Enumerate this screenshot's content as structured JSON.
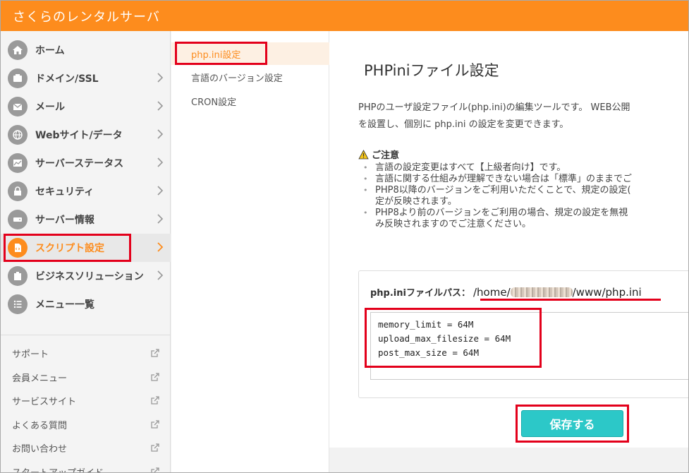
{
  "header": {
    "logo": "さくらのレンタルサーバ"
  },
  "sidebar": {
    "items": [
      {
        "label": "ホーム",
        "icon": "home-icon",
        "chevron": false
      },
      {
        "label": "ドメイン/SSL",
        "icon": "domain-icon",
        "chevron": true
      },
      {
        "label": "メール",
        "icon": "mail-icon",
        "chevron": true
      },
      {
        "label": "Webサイト/データ",
        "icon": "globe-icon",
        "chevron": true
      },
      {
        "label": "サーバーステータス",
        "icon": "chart-icon",
        "chevron": true
      },
      {
        "label": "セキュリティ",
        "icon": "lock-icon",
        "chevron": true
      },
      {
        "label": "サーバー情報",
        "icon": "server-icon",
        "chevron": true
      },
      {
        "label": "スクリプト設定",
        "icon": "script-icon",
        "chevron": true,
        "active": true
      },
      {
        "label": "ビジネスソリューション",
        "icon": "business-icon",
        "chevron": true
      },
      {
        "label": "メニュー一覧",
        "icon": "list-icon",
        "chevron": false
      }
    ],
    "links": [
      "サポート",
      "会員メニュー",
      "サービスサイト",
      "よくある質問",
      "お問い合わせ",
      "スタートアップガイド"
    ]
  },
  "subnav": {
    "items": [
      "php.ini設定",
      "言語のバージョン設定",
      "CRON設定"
    ]
  },
  "main": {
    "title": "PHPiniファイル設定",
    "desc_line1": "PHPのユーザ設定ファイル(php.ini)の編集ツールです。 WEB公開",
    "desc_line2": "を設置し、個別に php.ini の設定を変更できます。",
    "notice_title": "ご注意",
    "notices": [
      "言語の設定変更はすべて【上級者向け】です。",
      "言語に関する仕組みが理解できない場合は「標準」のままでご",
      "PHP8以降のバージョンをご利用いただくことで、規定の設定(",
      "定が反映されます。",
      "PHP8より前のバージョンをご利用の場合、規定の設定を無視",
      "み反映されますのでご注意ください。"
    ],
    "path_label": "php.iniファイルパス：",
    "path_prefix": "/home/",
    "path_suffix": "/www/php.ini",
    "editor_content": "memory_limit = 64M\nupload_max_filesize = 64M\npost_max_size = 64M",
    "save_label": "保存する"
  },
  "colors": {
    "brand": "#fd8c1d",
    "highlight": "#e3001b",
    "button": "#2cc8c8"
  }
}
